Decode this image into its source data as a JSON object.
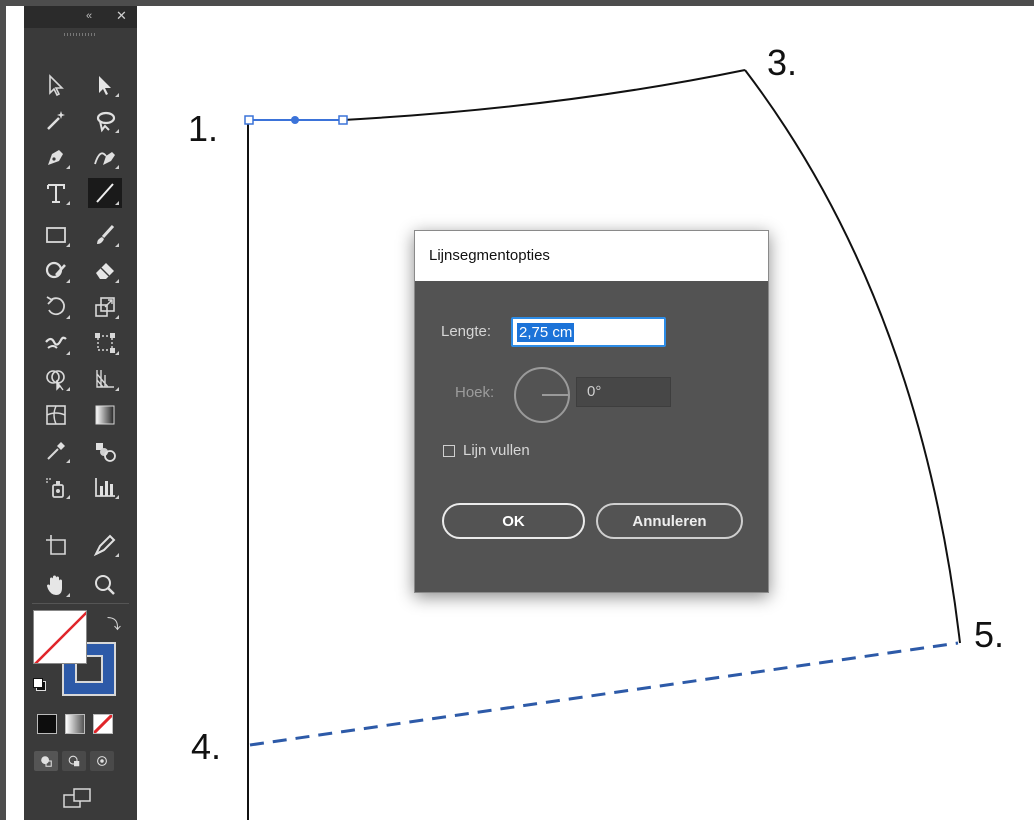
{
  "toolbar": {
    "collapse_icon": "«",
    "close_icon": "✕",
    "tools": [
      "selection-tool",
      "direct-selection-tool",
      "magic-wand-tool",
      "lasso-tool",
      "pen-tool",
      "curvature-tool",
      "type-tool",
      "line-segment-tool",
      "rectangle-tool",
      "paintbrush-tool",
      "shaper-tool",
      "eraser-tool",
      "rotate-tool",
      "scale-tool",
      "warp-tool",
      "free-transform-tool",
      "shape-builder-tool",
      "perspective-grid-tool",
      "mesh-tool",
      "gradient-tool",
      "eyedropper-tool",
      "blend-tool",
      "symbol-sprayer-tool",
      "column-graph-tool",
      "artboard-tool",
      "slice-tool",
      "hand-tool",
      "zoom-tool"
    ],
    "active_tool": "line-segment-tool"
  },
  "canvas": {
    "labels": [
      "1.",
      "3.",
      "4.",
      "5."
    ],
    "dashed_line_color": "#2d5aa8",
    "selection_color": "#3b73d9"
  },
  "dialog": {
    "title": "Lijnsegmentopties",
    "length_label": "Lengte:",
    "length_value": "2,75 cm",
    "angle_label": "Hoek:",
    "angle_value": "0°",
    "fill_line_label": "Lijn vullen",
    "fill_line_checked": false,
    "ok_label": "OK",
    "cancel_label": "Annuleren"
  }
}
